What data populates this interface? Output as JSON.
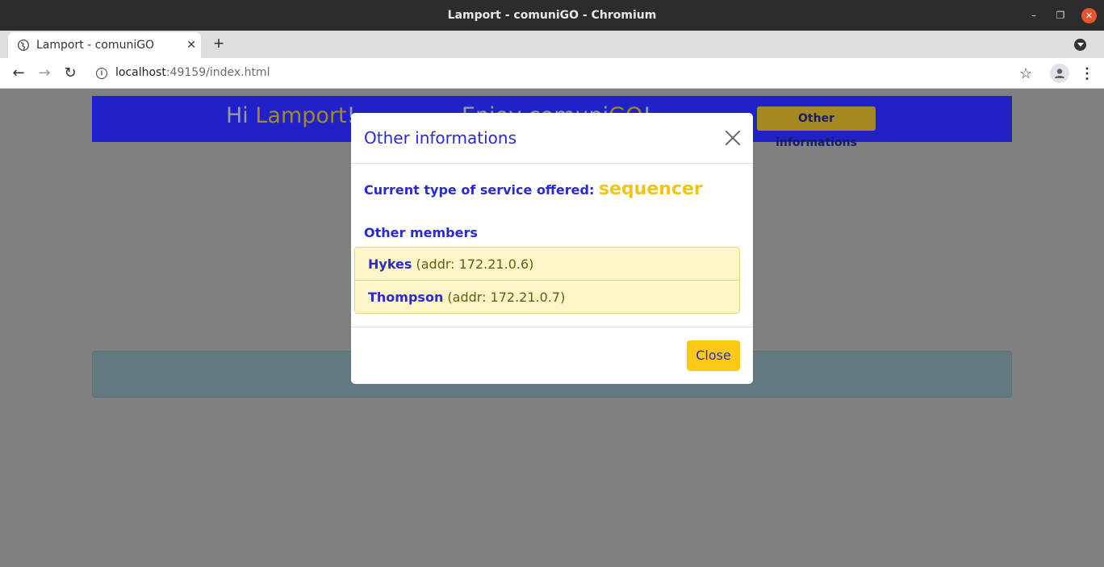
{
  "window": {
    "title": "Lamport - comuniGO - Chromium",
    "min_glyph": "–",
    "max_glyph": "❐",
    "close_glyph": "✕"
  },
  "tab": {
    "title": "Lamport - comuniGO",
    "close_glyph": "✕",
    "new_tab_glyph": "+"
  },
  "toolbar": {
    "back_glyph": "←",
    "forward_glyph": "→",
    "reload_glyph": "↻",
    "info_glyph": "i",
    "url_host": "localhost",
    "url_rest": ":49159/index.html",
    "star_glyph": "☆",
    "menu_glyph": "⋮"
  },
  "header": {
    "greeting_prefix": "Hi ",
    "user_name": "Lamport",
    "greeting_suffix": "!",
    "enjoy_prefix": "Enjoy comuni",
    "enjoy_brand": "GO",
    "enjoy_suffix": "!",
    "other_button_label": "Other informations"
  },
  "modal": {
    "title": "Other informations",
    "service_label": "Current type of service offered: ",
    "service_value": "sequencer",
    "members_title": "Other members",
    "members": [
      {
        "name": "Hykes",
        "addr": " (addr: 172.21.0.6)"
      },
      {
        "name": "Thompson",
        "addr": " (addr: 172.21.0.7)"
      }
    ],
    "close_label": "Close"
  },
  "colors": {
    "primary": "#2a2ad4",
    "accent": "#fcc914",
    "header_band": "#2121c8",
    "overlay": "#808080"
  }
}
